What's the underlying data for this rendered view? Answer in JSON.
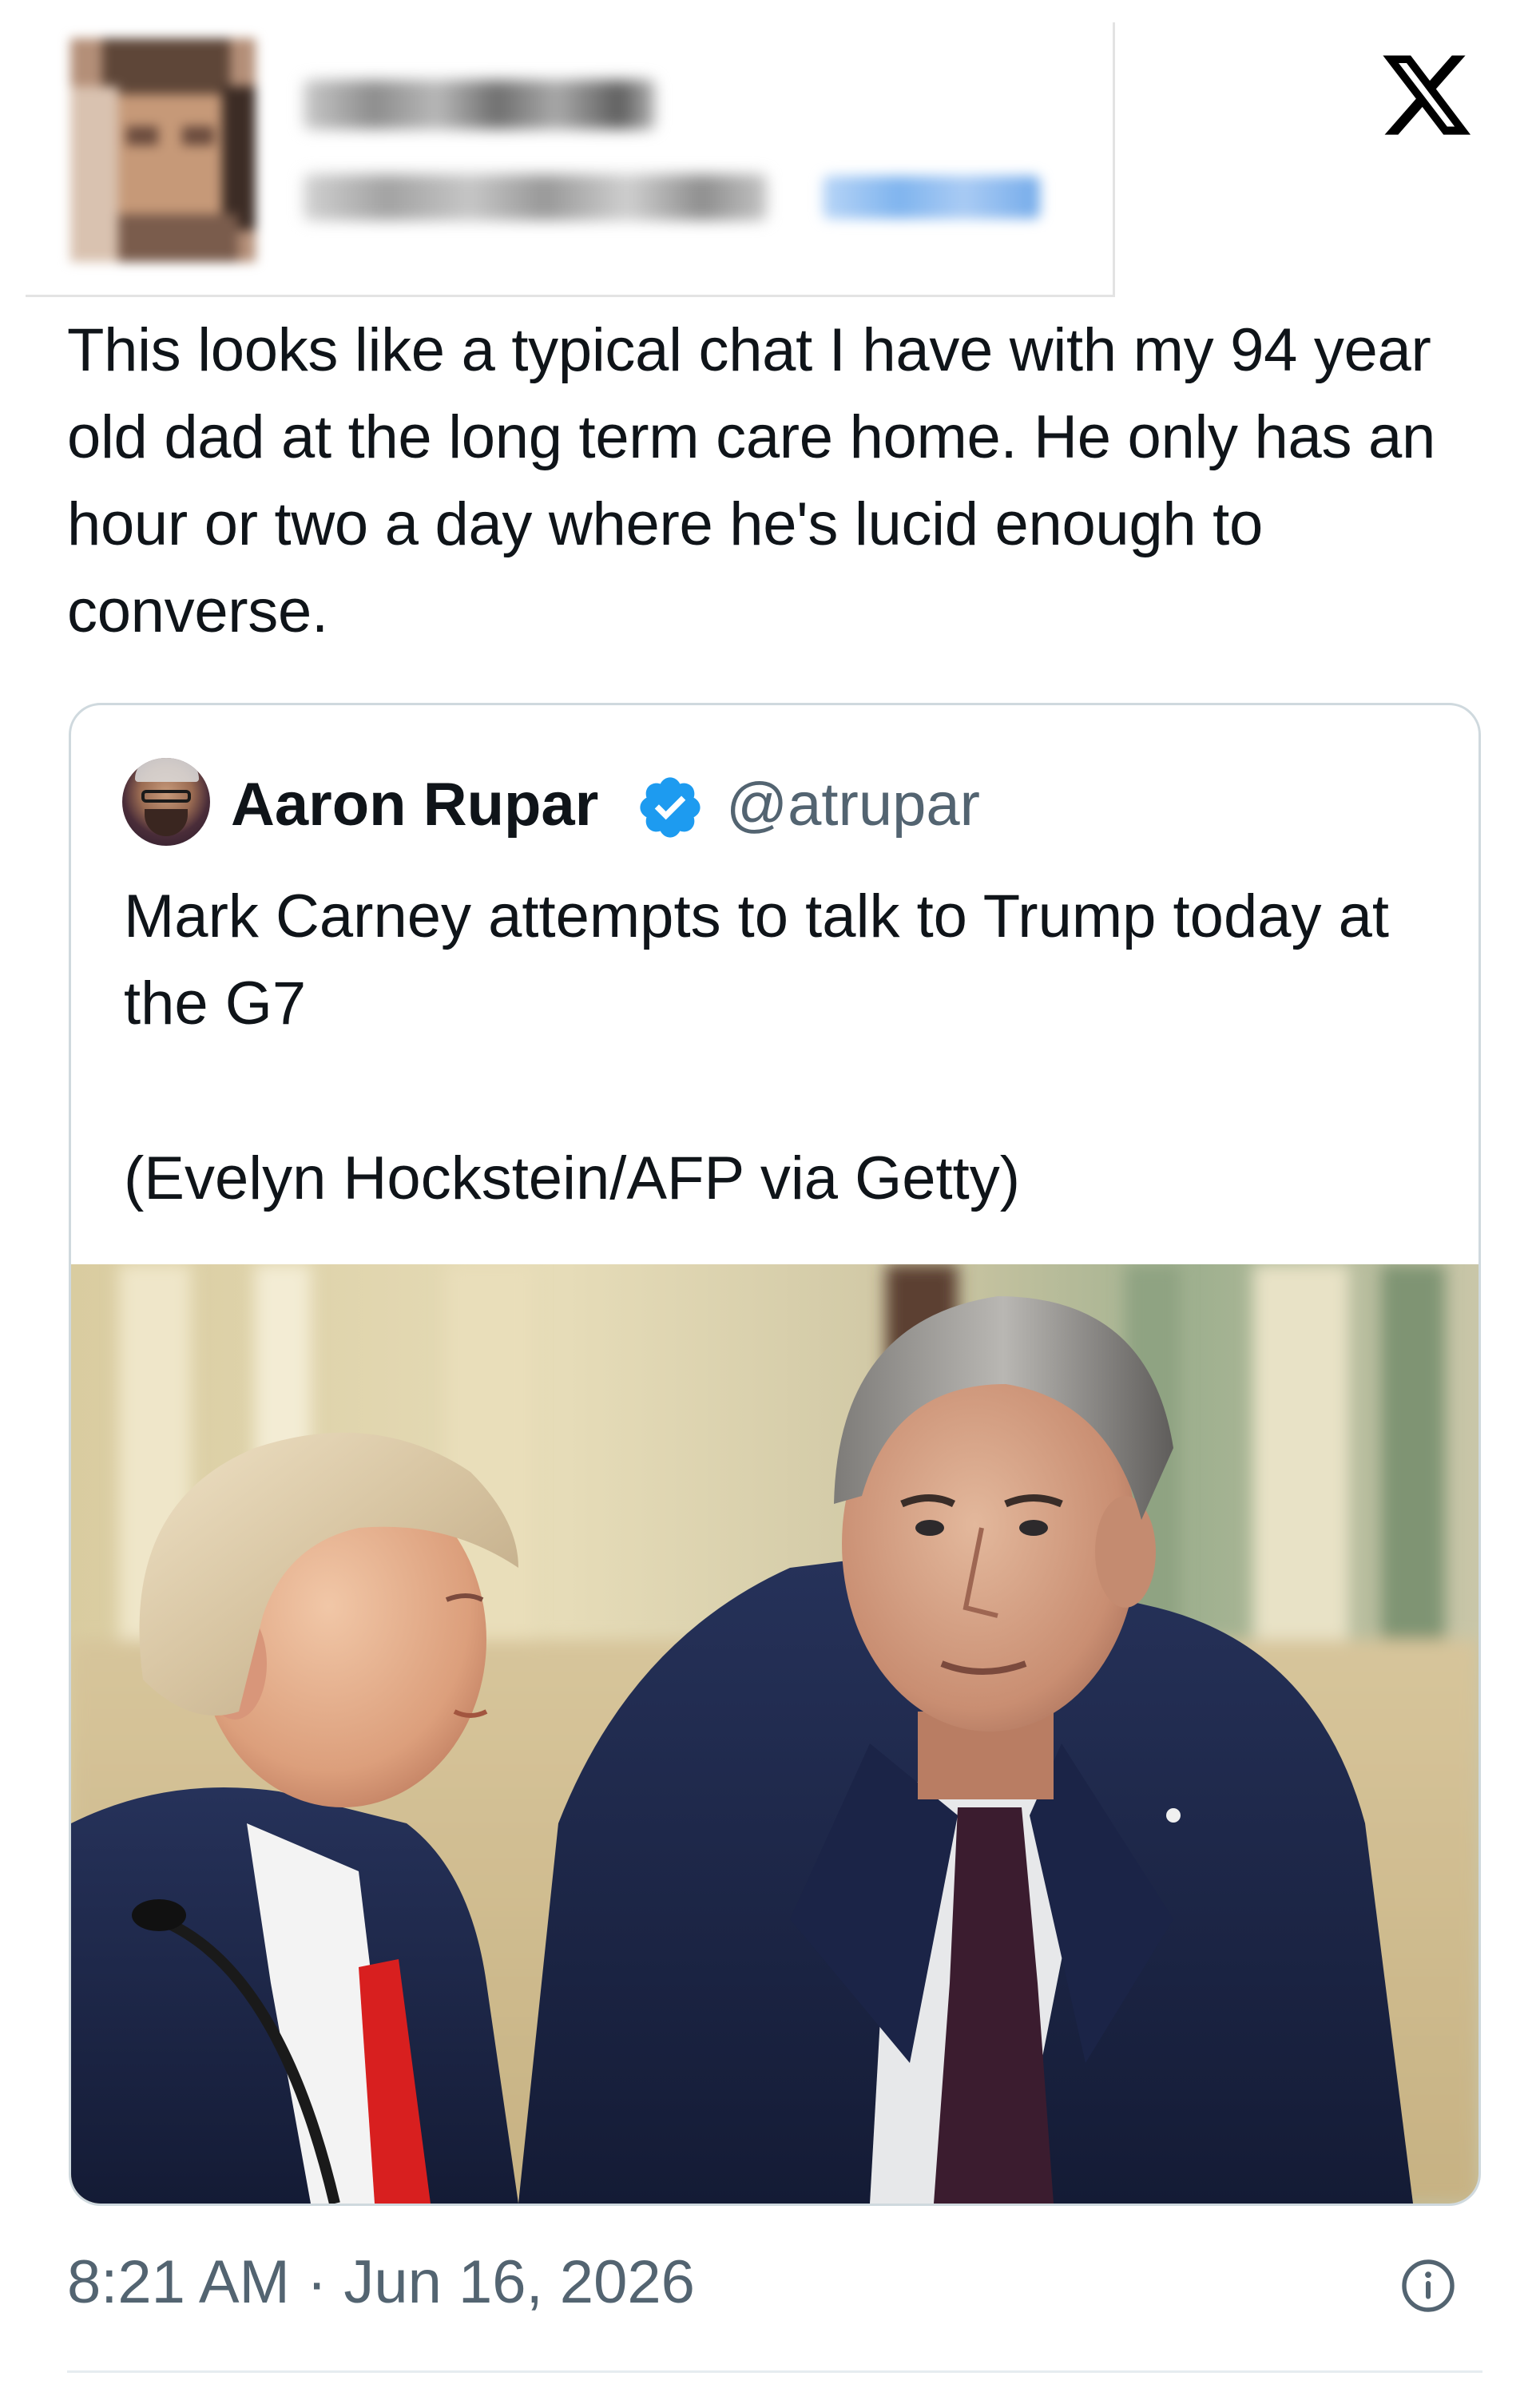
{
  "header": {
    "author_avatar": "blurred-avatar",
    "author_name": "",
    "author_handle": "",
    "follow_label": "",
    "logo_icon": "x-logo-icon"
  },
  "tweet": {
    "text": "This looks like a typical chat I have with my 94 year old dad at the long term care home. He only has an hour or two a day where he's lucid enough to converse."
  },
  "quoted_tweet": {
    "author_name": "Aaron Rupar",
    "verified_icon": "verified-badge-icon",
    "handle": "@atrupar",
    "text": "Mark Carney attempts to talk to Trump today at the G7",
    "caption": "(Evelyn Hockstein/AFP via Getty)",
    "photo": "photo-two-men-in-suits-talking"
  },
  "footer": {
    "timestamp": "8:21 AM · Jun 16, 2026",
    "info_icon": "info-icon"
  },
  "colors": {
    "text_primary": "#0f1419",
    "text_secondary": "#536471",
    "verified_blue": "#1d9bf0",
    "border": "#cfd9de"
  }
}
